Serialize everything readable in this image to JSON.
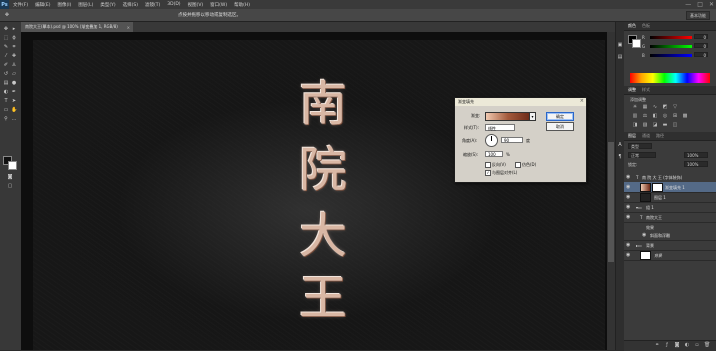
{
  "app": {
    "logo": "Ps",
    "menu": [
      "文件(F)",
      "编辑(E)",
      "图像(I)",
      "图层(L)",
      "类型(Y)",
      "选择(S)",
      "滤镜(T)",
      "3D(D)",
      "视图(V)",
      "窗口(W)",
      "帮助(H)"
    ],
    "window_controls": [
      "—",
      "□",
      "✕"
    ]
  },
  "options_bar": {
    "hint": "点按并拖移以移动或复制选区。",
    "workspace": "基本功能"
  },
  "document": {
    "tab_title": "南院大王(摹本).psd @ 100% (渐变叠加 1, RGB/8)",
    "tab_close": "×"
  },
  "canvas_text": [
    "南",
    "院",
    "大",
    "王"
  ],
  "gradient_dialog": {
    "title": "渐变填充",
    "close": "×",
    "gradient_label": "渐变:",
    "style_label": "样式(T):",
    "style_value": "线性",
    "angle_label": "角度(A):",
    "angle_value": "90",
    "angle_unit": "度",
    "scale_label": "缩放(S):",
    "scale_value": "100",
    "scale_unit": "%",
    "reverse_label": "反向(V)",
    "dither_label": "仿色(D)",
    "align_label": "与图层对齐(L)",
    "align_checked": "✓",
    "ok_label": "确定",
    "cancel_label": "取消",
    "gradient_colors": [
      "#f0c9b0",
      "#a35a3c",
      "#6d2a18"
    ]
  },
  "color_panel": {
    "tabs": [
      "颜色",
      "色板"
    ],
    "rows": [
      {
        "label": "R",
        "value": "0"
      },
      {
        "label": "G",
        "value": "0"
      },
      {
        "label": "B",
        "value": "0"
      }
    ]
  },
  "adjustments_panel": {
    "tabs": [
      "调整",
      "样式"
    ],
    "title": "添加调整"
  },
  "layers_panel": {
    "tabs": [
      "图层",
      "通道",
      "路径"
    ],
    "kind": "类型",
    "blend_mode": "正常",
    "opacity": "100%",
    "fill": "100%",
    "lock_label": "锁定:",
    "layers": [
      {
        "name": "南 院 大 王 (字体装饰)",
        "type": "T"
      },
      {
        "name": "渐变填充 1",
        "type": "fill",
        "selected": true
      },
      {
        "name": "图层 1",
        "type": "pixel"
      },
      {
        "name": "组 1",
        "type": "group"
      },
      {
        "name": "南院大王",
        "type": "T"
      },
      {
        "name": "效果",
        "type": "fx"
      },
      {
        "name": "斜面和浮雕",
        "type": "fx"
      },
      {
        "name": "背景",
        "type": "group"
      },
      {
        "name": "背景",
        "type": "bg"
      }
    ]
  }
}
